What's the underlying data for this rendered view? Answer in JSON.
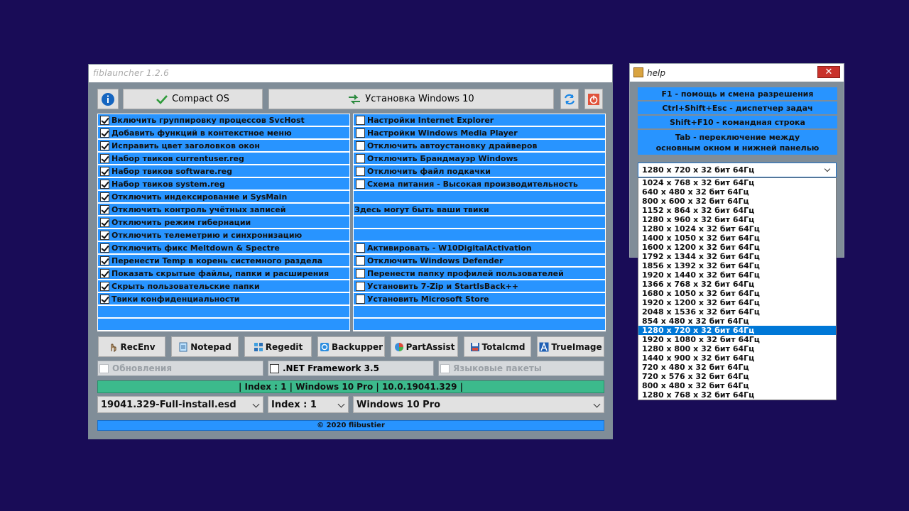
{
  "main": {
    "title": "fiblauncher 1.2.6",
    "compact_label": "Compact OS",
    "install_label": "Установка Windows 10"
  },
  "left_items": [
    {
      "label": "Включить группировку процессов SvcHost",
      "checked": true
    },
    {
      "label": "Добавить функций в контекстное меню",
      "checked": true
    },
    {
      "label": "Исправить цвет заголовков окон",
      "checked": true
    },
    {
      "label": "Набор твиков currentuser.reg",
      "checked": true
    },
    {
      "label": "Набор твиков software.reg",
      "checked": true
    },
    {
      "label": "Набор твиков system.reg",
      "checked": true
    },
    {
      "label": "Отключить индексирование и SysMain",
      "checked": true
    },
    {
      "label": "Отключить контроль учётных записей",
      "checked": true
    },
    {
      "label": "Отключить режим гибернации",
      "checked": true
    },
    {
      "label": "Отключить телеметрию и синхронизацию",
      "checked": true
    },
    {
      "label": "Отключить фикс Meltdown & Spectre",
      "checked": true
    },
    {
      "label": "Перенести Temp в корень системного раздела",
      "checked": true
    },
    {
      "label": "Показать скрытые файлы, папки и расширения",
      "checked": true
    },
    {
      "label": "Скрыть пользовательские папки",
      "checked": true
    },
    {
      "label": "Твики конфиденциальности",
      "checked": true
    }
  ],
  "right_items": [
    {
      "label": "Настройки Internet Explorer",
      "checkbox": true
    },
    {
      "label": "Настройки Windows Media Player",
      "checkbox": true
    },
    {
      "label": "Отключить автоустановку драйверов",
      "checkbox": true
    },
    {
      "label": "Отключить Брандмауэр Windows",
      "checkbox": true
    },
    {
      "label": "Отключить файл подкачки",
      "checkbox": true
    },
    {
      "label": "Схема питания - Высокая производительность",
      "checkbox": true
    },
    {
      "label": "",
      "checkbox": false
    },
    {
      "label": "Здесь могут быть ваши твики",
      "checkbox": false
    },
    {
      "label": "",
      "checkbox": false
    },
    {
      "label": "",
      "checkbox": false
    },
    {
      "label": "Активировать - W10DigitalActivation",
      "checkbox": true
    },
    {
      "label": "Отключить Windows Defender",
      "checkbox": true
    },
    {
      "label": "Перенести папку профилей пользователей",
      "checkbox": true
    },
    {
      "label": "Установить 7-Zip и StartIsBack++",
      "checkbox": true
    },
    {
      "label": "Установить Microsoft Store",
      "checkbox": true
    }
  ],
  "tools": [
    "RecEnv",
    "Notepad",
    "Regedit",
    "Backupper",
    "PartAssist",
    "Totalcmd",
    "TrueImage"
  ],
  "options": {
    "updates": "Обновления",
    "netfx": ".NET Framework 3.5",
    "langpacks": "Языковые пакеты"
  },
  "status_text": "| Index : 1 | Windows 10 Pro | 10.0.19041.329 |",
  "selects": {
    "file": "19041.329-Full-install.esd",
    "index": "Index : 1",
    "edition": "Windows 10 Pro"
  },
  "footer": "© 2020 flibustier",
  "help": {
    "title": "help",
    "close": "✕",
    "lines": [
      "F1 - помощь и смена разрешения",
      "Ctrl+Shift+Esc - диспетчер задач",
      "Shift+F10 - командная строка"
    ],
    "tab_line1": "Tab - переключение между",
    "tab_line2": "основным окном и нижней панелью",
    "current_resolution": "1280 x 720 x 32 бит 64Гц",
    "resolutions": [
      "1024 x 768 x 32 бит 64Гц",
      "640 x 480 x 32 бит 64Гц",
      "800 x 600 x 32 бит 64Гц",
      "1152 x 864 x 32 бит 64Гц",
      "1280 x 960 x 32 бит 64Гц",
      "1280 x 1024 x 32 бит 64Гц",
      "1400 x 1050 x 32 бит 64Гц",
      "1600 x 1200 x 32 бит 64Гц",
      "1792 x 1344 x 32 бит 64Гц",
      "1856 x 1392 x 32 бит 64Гц",
      "1920 x 1440 x 32 бит 64Гц",
      "1366 x 768 x 32 бит 64Гц",
      "1680 x 1050 x 32 бит 64Гц",
      "1920 x 1200 x 32 бит 64Гц",
      "2048 x 1536 x 32 бит 64Гц",
      "854 x 480 x 32 бит 64Гц",
      "1280 x 720 x 32 бит 64Гц",
      "1920 x 1080 x 32 бит 64Гц",
      "1280 x 800 x 32 бит 64Гц",
      "1440 x 900 x 32 бит 64Гц",
      "720 x 480 x 32 бит 64Гц",
      "720 x 576 x 32 бит 64Гц",
      "800 x 480 x 32 бит 64Гц",
      "1280 x 768 x 32 бит 64Гц"
    ],
    "selected_index": 16
  }
}
